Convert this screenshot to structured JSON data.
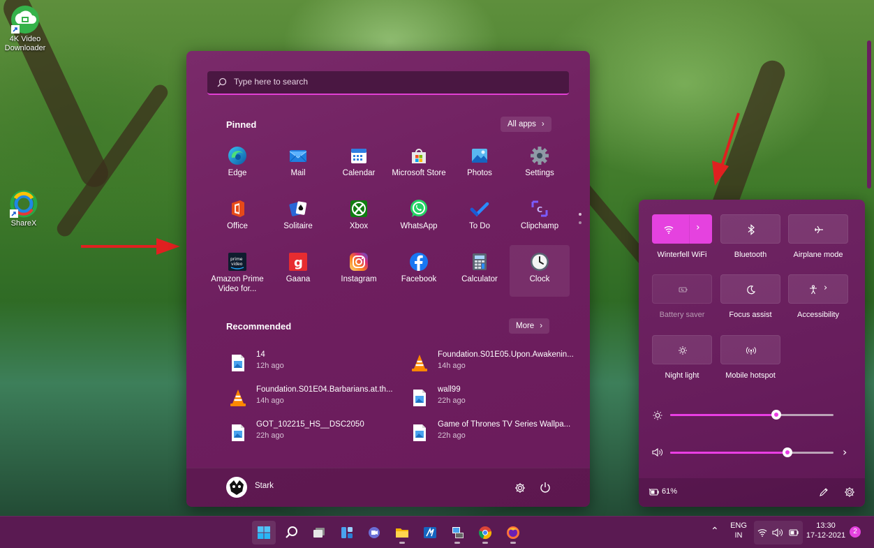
{
  "desktop": {
    "icons": [
      {
        "label": "4K Video\nDownloader",
        "label_line1": "4K Video",
        "label_line2": "Downloader"
      },
      {
        "label": "ShareX"
      }
    ]
  },
  "start": {
    "search_placeholder": "Type here to search",
    "pinned_title": "Pinned",
    "all_apps_label": "All apps",
    "pinned": [
      {
        "label": "Edge",
        "icon": "edge-icon"
      },
      {
        "label": "Mail",
        "icon": "mail-icon"
      },
      {
        "label": "Calendar",
        "icon": "calendar-icon"
      },
      {
        "label": "Microsoft Store",
        "icon": "store-icon"
      },
      {
        "label": "Photos",
        "icon": "photos-icon"
      },
      {
        "label": "Settings",
        "icon": "settings-gear-icon"
      },
      {
        "label": "Office",
        "icon": "office-icon"
      },
      {
        "label": "Solitaire",
        "icon": "solitaire-icon"
      },
      {
        "label": "Xbox",
        "icon": "xbox-icon"
      },
      {
        "label": "WhatsApp",
        "icon": "whatsapp-icon"
      },
      {
        "label": "To Do",
        "icon": "todo-check-icon"
      },
      {
        "label": "Clipchamp",
        "icon": "clipchamp-icon"
      },
      {
        "label": "Amazon Prime Video for...",
        "label_line1": "Amazon Prime",
        "label_line2": "Video for...",
        "icon": "prime-video-icon"
      },
      {
        "label": "Gaana",
        "icon": "gaana-icon"
      },
      {
        "label": "Instagram",
        "icon": "instagram-icon"
      },
      {
        "label": "Facebook",
        "icon": "facebook-icon"
      },
      {
        "label": "Calculator",
        "icon": "calculator-icon"
      },
      {
        "label": "Clock",
        "icon": "clock-icon"
      }
    ],
    "recommended_title": "Recommended",
    "more_label": "More",
    "recommended": [
      {
        "name": "14",
        "time": "12h ago",
        "icon": "image-file-icon"
      },
      {
        "name": "Foundation.S01E05.Upon.Awakenin...",
        "time": "14h ago",
        "icon": "vlc-icon"
      },
      {
        "name": "Foundation.S01E04.Barbarians.at.th...",
        "time": "14h ago",
        "icon": "vlc-icon"
      },
      {
        "name": "wall99",
        "time": "22h ago",
        "icon": "image-file-icon"
      },
      {
        "name": "GOT_102215_HS__DSC2050",
        "time": "22h ago",
        "icon": "image-file-icon"
      },
      {
        "name": "Game of Thrones TV Series Wallpa...",
        "time": "22h ago",
        "icon": "image-file-icon"
      }
    ],
    "user_name": "Stark"
  },
  "quick_settings": {
    "tiles": [
      {
        "label": "Winterfell WiFi",
        "icon": "wifi-icon",
        "state": "on"
      },
      {
        "label": "Bluetooth",
        "icon": "bluetooth-icon",
        "state": "off"
      },
      {
        "label": "Airplane mode",
        "icon": "airplane-icon",
        "state": "off"
      },
      {
        "label": "Battery saver",
        "icon": "battery-saver-icon",
        "state": "disabled"
      },
      {
        "label": "Focus assist",
        "icon": "moon-icon",
        "state": "off"
      },
      {
        "label": "Accessibility",
        "icon": "accessibility-icon",
        "state": "off"
      },
      {
        "label": "Night light",
        "icon": "sun-icon",
        "state": "off"
      },
      {
        "label": "Mobile hotspot",
        "icon": "hotspot-icon",
        "state": "off"
      }
    ],
    "brightness": 0.65,
    "volume": 0.72,
    "battery_label": "61%"
  },
  "taskbar": {
    "apps": [
      "start-icon",
      "search-icon",
      "task-view-icon",
      "widgets-icon",
      "teams-chat-icon",
      "file-explorer-icon",
      "autodesk-icon",
      "network-tool-icon",
      "chrome-icon",
      "firefox-icon"
    ],
    "lang_line1": "ENG",
    "lang_line2": "IN",
    "time": "13:30",
    "date": "17-12-2021",
    "notification_count": "2"
  },
  "colors": {
    "accent": "#e542df",
    "start_bg": "#6e1f5f",
    "taskbar_bg": "#5a1a52",
    "annotation_arrow": "#e02020"
  }
}
